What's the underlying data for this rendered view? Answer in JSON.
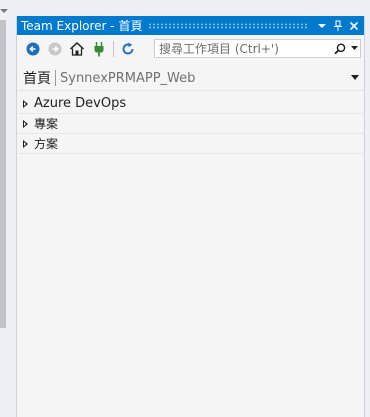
{
  "window": {
    "title": "Team Explorer - 首頁",
    "accent_color": "#007acc",
    "buttons": [
      "dropdown-icon",
      "pin-icon",
      "close-icon"
    ]
  },
  "toolbar": {
    "icons": [
      "back-icon",
      "forward-icon",
      "home-icon",
      "connect-icon",
      "refresh-icon"
    ],
    "search": {
      "placeholder": "搜尋工作項目 (Ctrl+')",
      "icon": "search-icon"
    }
  },
  "header": {
    "page_title": "首頁",
    "context": "SynnexPRMAPP_Web"
  },
  "sections": [
    {
      "label": "Azure DevOps",
      "expanded": false
    },
    {
      "label": "專案",
      "expanded": false
    },
    {
      "label": "方案",
      "expanded": false
    }
  ]
}
